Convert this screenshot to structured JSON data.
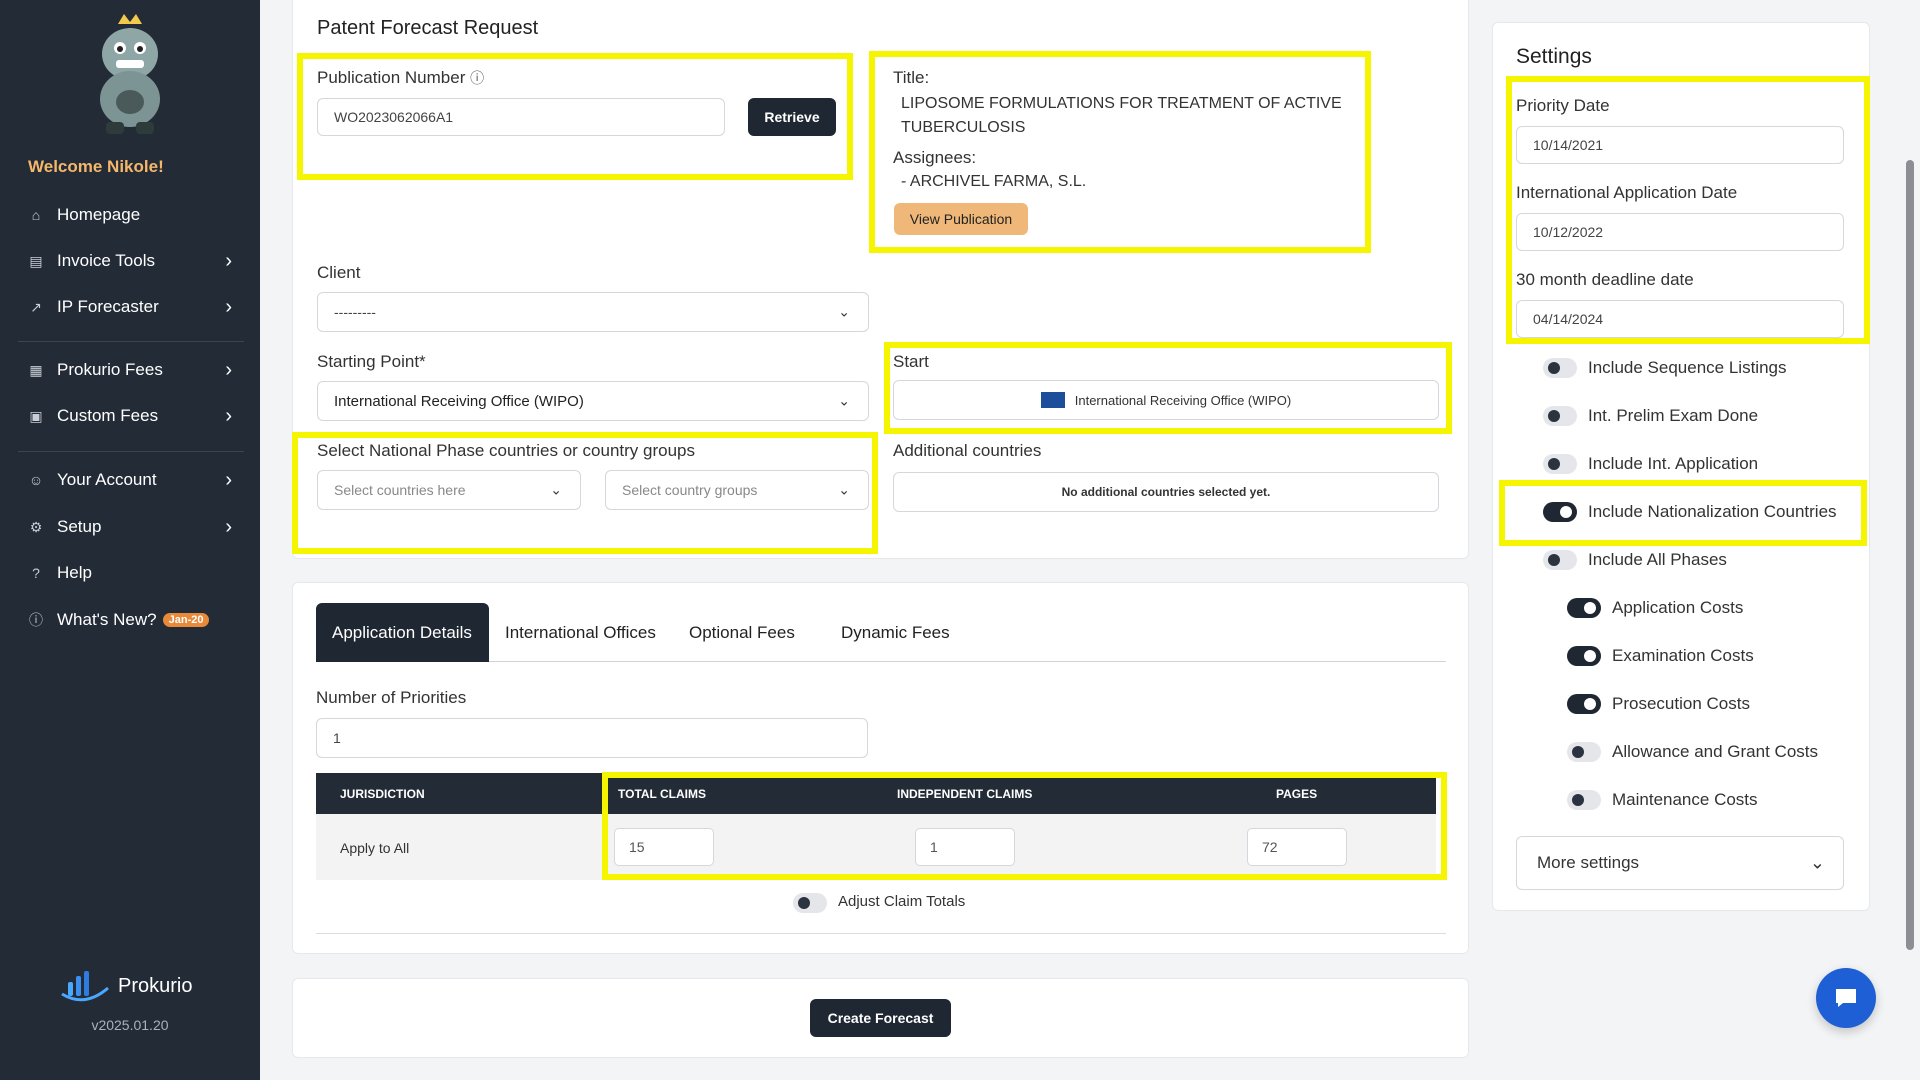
{
  "sidebar": {
    "welcome": "Welcome Nikole!",
    "items": [
      {
        "label": "Homepage",
        "icon": "home-icon"
      },
      {
        "label": "Invoice Tools",
        "icon": "invoice-icon"
      },
      {
        "label": "IP Forecaster",
        "icon": "chart-icon"
      },
      {
        "label": "Prokurio Fees",
        "icon": "building-icon"
      },
      {
        "label": "Custom Fees",
        "icon": "monitor-icon"
      },
      {
        "label": "Your Account",
        "icon": "users-icon"
      },
      {
        "label": "Setup",
        "icon": "gear-icon"
      },
      {
        "label": "Help",
        "icon": "question-icon"
      },
      {
        "label": "What's New?",
        "icon": "info-icon",
        "badge": "Jan-20"
      }
    ],
    "brand": "Prokurio",
    "version": "v2025.01.20"
  },
  "request": {
    "heading": "Patent Forecast Request",
    "pub_label": "Publication Number",
    "pub_value": "WO2023062066A1",
    "retrieve": "Retrieve",
    "title_label": "Title:",
    "title_value": "LIPOSOME FORMULATIONS FOR TREATMENT OF ACTIVE TUBERCULOSIS",
    "assignees_label": "Assignees:",
    "assignees_value": "- ARCHIVEL FARMA, S.L.",
    "view_pub": "View Publication",
    "client_label": "Client",
    "client_value": "---------",
    "start_point_label": "Starting Point*",
    "start_point_value": "International Receiving Office (WIPO)",
    "start_label": "Start",
    "start_value": "International Receiving Office (WIPO)",
    "national_label": "Select National Phase countries or country groups",
    "countries_placeholder": "Select countries here",
    "groups_placeholder": "Select country groups",
    "additional_label": "Additional countries",
    "additional_empty": "No additional countries selected yet."
  },
  "details": {
    "tabs": [
      "Application Details",
      "International Offices",
      "Optional Fees",
      "Dynamic Fees"
    ],
    "priorities_label": "Number of Priorities",
    "priorities_value": "1",
    "columns": [
      "JURISDICTION",
      "TOTAL CLAIMS",
      "INDEPENDENT CLAIMS",
      "PAGES"
    ],
    "row": {
      "jurisdiction": "Apply to All",
      "total_claims": "15",
      "independent_claims": "1",
      "pages": "72"
    },
    "adjust": "Adjust Claim Totals",
    "create": "Create Forecast"
  },
  "settings": {
    "heading": "Settings",
    "priority_date_label": "Priority Date",
    "priority_date": "10/14/2021",
    "intl_date_label": "International Application Date",
    "intl_date": "10/12/2022",
    "deadline_label": "30 month deadline date",
    "deadline": "04/14/2024",
    "toggles": [
      {
        "label": "Include Sequence Listings",
        "on": false
      },
      {
        "label": "Int. Prelim Exam Done",
        "on": false
      },
      {
        "label": "Include Int. Application",
        "on": false
      },
      {
        "label": "Include Nationalization Countries",
        "on": true
      },
      {
        "label": "Include All Phases",
        "on": false
      },
      {
        "label": "Application Costs",
        "on": true
      },
      {
        "label": "Examination Costs",
        "on": true
      },
      {
        "label": "Prosecution Costs",
        "on": true
      },
      {
        "label": "Allowance and Grant Costs",
        "on": false
      },
      {
        "label": "Maintenance Costs",
        "on": false
      }
    ],
    "more": "More settings"
  },
  "colors": {
    "highlight": "#f5f500",
    "dark": "#1f2733",
    "accent": "#f5b76a"
  }
}
